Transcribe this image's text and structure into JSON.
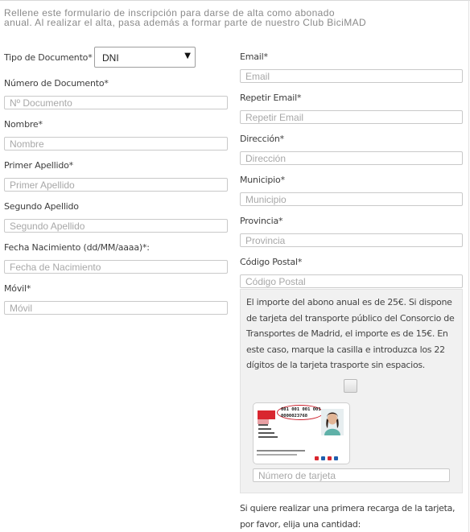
{
  "intro": {
    "line1": "Rellene este formulario de inscripción para darse de alta como abonado",
    "line2": "anual. Al realizar el alta, pasa además a formar parte de nuestro Club BiciMAD"
  },
  "left_column": {
    "tipo_documento": {
      "label": "Tipo de Documento*",
      "selected": "DNI",
      "arrow": "▼"
    },
    "numero_documento": {
      "label": "Número de Documento*",
      "placeholder": "Nº Documento"
    },
    "nombre": {
      "label": "Nombre*",
      "placeholder": "Nombre"
    },
    "primer_apellido": {
      "label": "Primer Apellido*",
      "placeholder": "Primer Apellido"
    },
    "segundo_apellido": {
      "label": "Segundo Apellido",
      "placeholder": "Segundo Apellido"
    },
    "fecha_nacimiento": {
      "label": "Fecha Nacimiento (dd/MM/aaaa)*:",
      "placeholder": "Fecha de Nacimiento"
    },
    "movil": {
      "label": "Móvil*",
      "placeholder": "Móvil"
    }
  },
  "right_column": {
    "email": {
      "label": "Email*",
      "placeholder": "Email"
    },
    "repetir_email": {
      "label": "Repetir Email*",
      "placeholder": "Repetir Email"
    },
    "direccion": {
      "label": "Dirección*",
      "placeholder": "Dirección"
    },
    "municipio": {
      "label": "Municipio*",
      "placeholder": "Municipio"
    },
    "provincia": {
      "label": "Provincia*",
      "placeholder": "Provincia"
    },
    "codigo_postal": {
      "label": "Código Postal*",
      "placeholder": "Código Postal"
    }
  },
  "transport_card": {
    "info_text": "El importe del abono anual es de 25€. Si dispone de tarjeta del transporte público del Consorcio de Transportes de Madrid, el importe es de 15€. En este caso, marque la casilla e introduzca los 22 dígitos de la tarjeta trasporte sin espacios.",
    "checked": false,
    "card_number_line1": "001 001 001 001",
    "card_number_line2": "0000023768",
    "input_placeholder": "Número de tarjeta"
  },
  "recharge": {
    "text": "Si quiere realizar una primera recarga de la tarjeta, por favor, elija una cantidad:"
  },
  "colors": {
    "panel_bg": "#f1f1f1",
    "border": "#c9c9c9",
    "card_red": "#d9262f"
  }
}
